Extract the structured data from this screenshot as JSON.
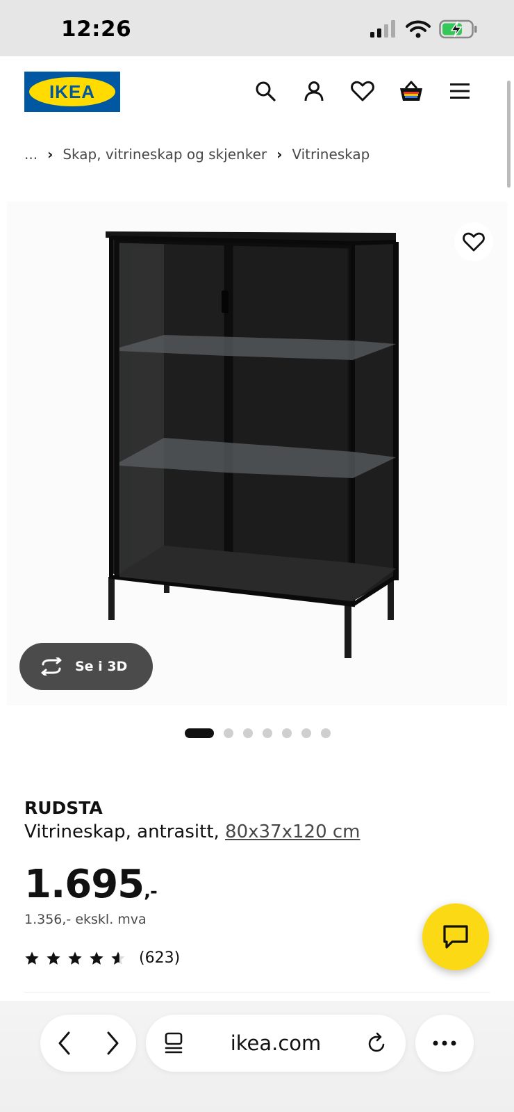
{
  "status_bar": {
    "time": "12:26"
  },
  "header": {
    "logo_text": "IKEA",
    "icons": [
      "search-icon",
      "user-icon",
      "heart-icon",
      "basket-icon",
      "menu-icon"
    ]
  },
  "breadcrumb": {
    "ellipsis": "...",
    "items": [
      "Skap, vitrineskap og skjenker",
      "Vitrineskap"
    ]
  },
  "gallery": {
    "view_3d_label": "Se i 3D",
    "dot_count": 7,
    "active_index": 0
  },
  "product": {
    "name": "RUDSTA",
    "description": "Vitrineskap, antrasitt, ",
    "dimensions": "80x37x120 cm",
    "price": "1.695",
    "price_suffix": ",-",
    "price_ex_vat": "1.356,- ekskl. mva",
    "rating": 4.5,
    "rating_count": "(623)"
  },
  "browser": {
    "url": "ikea.com"
  },
  "colors": {
    "ikea_blue": "#0058a3",
    "ikea_yellow": "#ffdb00",
    "chat_yellow": "#fbd914"
  }
}
